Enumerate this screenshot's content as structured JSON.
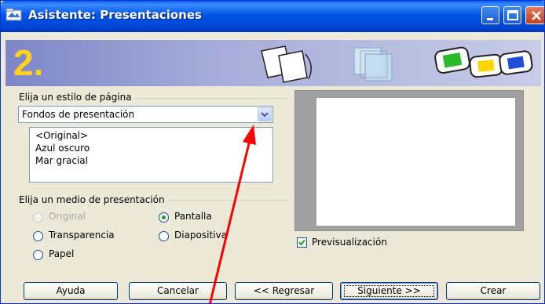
{
  "window": {
    "title": "Asistente: Presentaciones"
  },
  "banner": {
    "step": "2."
  },
  "page_style": {
    "group_label": "Elija un estilo de página",
    "selected": "Fondos de presentación",
    "options": [
      "<Original>",
      "Azul oscuro",
      "Mar gracial"
    ]
  },
  "medium": {
    "group_label": "Elija un medio de presentación",
    "options": [
      {
        "label": "Original",
        "selected": false,
        "enabled": false
      },
      {
        "label": "Pantalla",
        "selected": true,
        "enabled": true
      },
      {
        "label": "Transparencia",
        "selected": false,
        "enabled": true
      },
      {
        "label": "Diapositiva",
        "selected": false,
        "enabled": true
      },
      {
        "label": "Papel",
        "selected": false,
        "enabled": true
      }
    ]
  },
  "preview": {
    "checkbox_label": "Previsualización",
    "checked": true
  },
  "buttons": {
    "help": "Ayuda",
    "cancel": "Cancelar",
    "back": "<< Regresar",
    "next": "Siguiente >>",
    "create": "Crear"
  },
  "colors": {
    "titlebar": "#0055e5",
    "banner_start": "#7d86c7",
    "step_number": "#ffd21f",
    "annotation_arrow": "#ff0000",
    "window_bg": "#ece9d8"
  }
}
